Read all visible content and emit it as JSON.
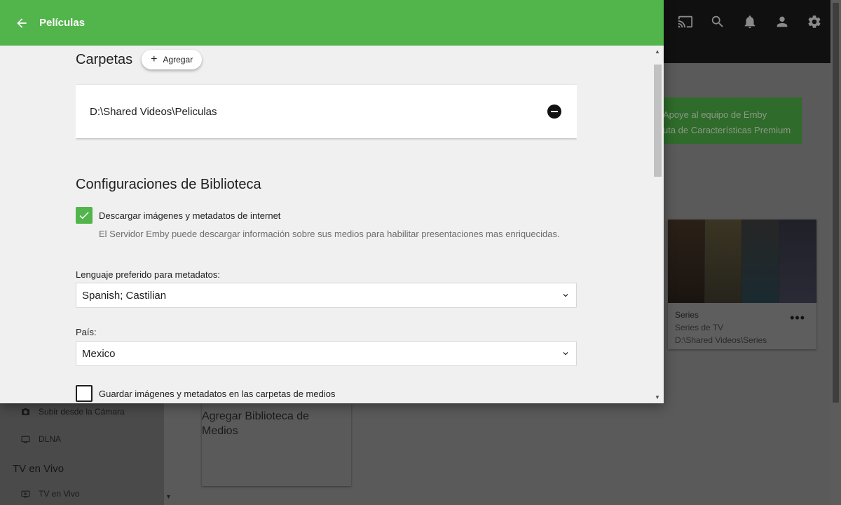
{
  "dialog": {
    "title": "Películas",
    "folders_heading": "Carpetas",
    "add_label": "Agregar",
    "folders": [
      "D:\\Shared Videos\\Peliculas"
    ],
    "settings_heading": "Configuraciones de Biblioteca",
    "download_checkbox": {
      "label": "Descargar imágenes y metadatos de internet",
      "description": "El Servidor Emby puede descargar información sobre sus medios para habilitar presentaciones mas enriquecidas.",
      "checked": true
    },
    "language": {
      "label": "Lenguaje preferido para metadatos:",
      "value": "Spanish; Castilian"
    },
    "country": {
      "label": "País:",
      "value": "Mexico"
    },
    "save_checkbox": {
      "label": "Guardar imágenes y metadatos en las carpetas de medios",
      "checked": false
    }
  },
  "background": {
    "top_icons": [
      "cast-icon",
      "search-icon",
      "bell-icon",
      "user-icon",
      "gear-icon"
    ],
    "promo": {
      "line1": "Apoye al equipo de Emby",
      "line2": "uta de Características Premium"
    },
    "series_card": {
      "name": "Series",
      "type": "Series de TV",
      "path": "D:\\Shared Videos\\Series"
    },
    "add_library_card": {
      "line1": "Agregar Biblioteca de",
      "line2": "Medios"
    },
    "sidebar": {
      "camera_upload": "Subir desde la Cámara",
      "dlna": "DLNA",
      "live_tv_heading": "TV en Vivo",
      "live_tv": "TV en Vivo"
    }
  },
  "colors": {
    "accent": "#52b54b",
    "header_text": "#ffffff",
    "overlay_bg": "#4f4f4f"
  }
}
